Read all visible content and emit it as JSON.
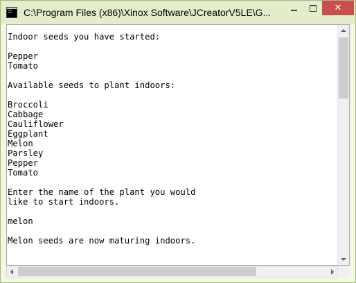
{
  "window": {
    "title": "C:\\Program Files (x86)\\Xinox Software\\JCreatorV5LE\\G...",
    "close_glyph": "✕"
  },
  "console": {
    "lines": [
      "Indoor seeds you have started:",
      "",
      "Pepper",
      "Tomato",
      "",
      "Available seeds to plant indoors:",
      "",
      "Broccoli",
      "Cabbage",
      "Cauliflower",
      "Eggplant",
      "Melon",
      "Parsley",
      "Pepper",
      "Tomato",
      "",
      "Enter the name of the plant you would",
      "like to start indoors.",
      "",
      "melon",
      "",
      "Melon seeds are now maturing indoors."
    ]
  },
  "colors": {
    "frame": "#f2f7e6",
    "titlebar": "#e4edcb",
    "close_button": "#c7504a",
    "console_bg": "#ffffff"
  },
  "icons": {
    "app": "console-app-icon",
    "minimize": "minimize-icon",
    "maximize": "maximize-icon",
    "close": "close-icon"
  }
}
